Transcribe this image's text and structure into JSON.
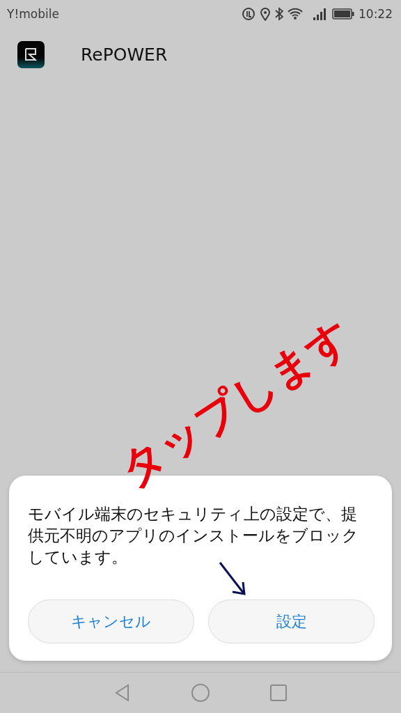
{
  "status_bar": {
    "carrier": "Y!mobile",
    "time": "10:22"
  },
  "app": {
    "name": "RePOWER"
  },
  "dialog": {
    "message": "モバイル端末のセキュリティ上の設定で、提供元不明のアプリのインストールをブロックしています。",
    "buttons": [
      {
        "label": "キャンセル"
      },
      {
        "label": "設定"
      }
    ]
  },
  "annotation": {
    "text": "タップします"
  }
}
